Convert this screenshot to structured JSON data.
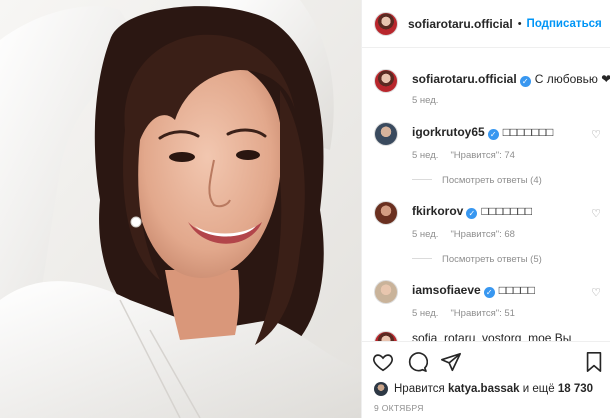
{
  "post": {
    "author": "sofiarotaru.official",
    "dot": "•",
    "follow_label": "Подписаться",
    "caption_author": "sofiarotaru.official",
    "caption_text": "С любовью ❤",
    "caption_time": "5 нед.",
    "photo_icon": "portrait-photo"
  },
  "comments": [
    {
      "user": "igorkrutoy65",
      "text": "□□□□□□□",
      "time": "5 нед.",
      "likes": "\"Нравится\": 74",
      "replies": "Посмотреть ответы (4)",
      "avatar": "#3a4a5e"
    },
    {
      "user": "fkirkorov",
      "text": "□□□□□□□",
      "time": "5 нед.",
      "likes": "\"Нравится\": 68",
      "replies": "Посмотреть ответы (5)",
      "avatar": "#6a3020"
    },
    {
      "user": "iamsofiaeve",
      "text": "□□□□□",
      "time": "5 нед.",
      "likes": "\"Нравится\": 51",
      "replies": "",
      "avatar": "#c9b39a"
    }
  ],
  "cut_comment": "sofia_rotaru_vostorg_moe Вы",
  "footer": {
    "likes_prefix": "Нравится",
    "likes_user": "katya.bassak",
    "likes_mid": "и ещё",
    "likes_count": "18 730",
    "date": "9 ОКТЯБРЯ"
  },
  "colors": {
    "link": "#0095f6",
    "muted": "#8e8e8e",
    "text": "#262626",
    "verified": "#3897f0"
  }
}
